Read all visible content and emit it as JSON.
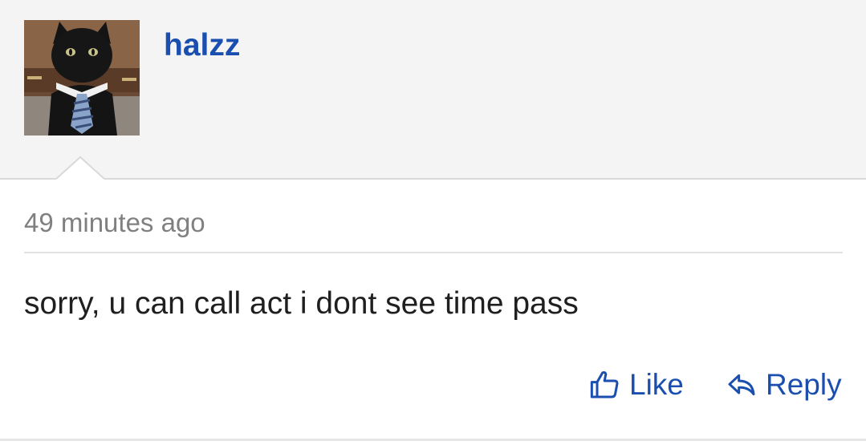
{
  "post": {
    "username": "halzz",
    "timestamp": "49 minutes ago",
    "comment_text": "sorry, u can call act i dont see time pass"
  },
  "actions": {
    "like_label": "Like",
    "reply_label": "Reply"
  },
  "icons": {
    "like": "thumbs-up-icon",
    "reply": "reply-arrow-icon"
  },
  "colors": {
    "link": "#1a4fb0",
    "header_bg": "#f4f4f4",
    "muted_text": "#808080"
  }
}
